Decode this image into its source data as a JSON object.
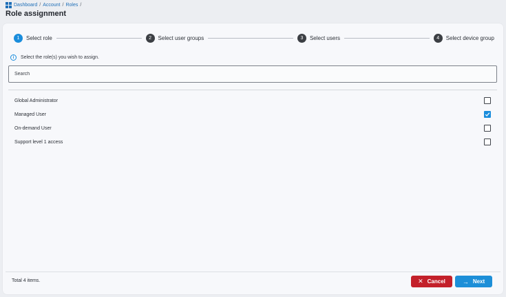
{
  "breadcrumb": {
    "items": [
      "Dashboard",
      "Account",
      "Roles"
    ],
    "separator": "/"
  },
  "page": {
    "title": "Role assignment"
  },
  "stepper": {
    "steps": [
      {
        "number": "1",
        "label": "Select role",
        "active": true
      },
      {
        "number": "2",
        "label": "Select user groups",
        "active": false
      },
      {
        "number": "3",
        "label": "Select users",
        "active": false
      },
      {
        "number": "4",
        "label": "Select device group",
        "active": false
      }
    ]
  },
  "info": {
    "icon": "info-icon",
    "text": "Select the role(s) you wish to assign."
  },
  "search": {
    "placeholder": "Search",
    "value": ""
  },
  "roles": [
    {
      "label": "Global Administrator",
      "checked": false
    },
    {
      "label": "Managed User",
      "checked": true
    },
    {
      "label": "On-demand User",
      "checked": false
    },
    {
      "label": "Support level 1 access",
      "checked": false
    }
  ],
  "footer": {
    "total_text": "Total 4 items.",
    "cancel_label": "Cancel",
    "next_label": "Next"
  },
  "colors": {
    "accent": "#1a8ddc",
    "cancel": "#c3202a",
    "next": "#1d8fd8",
    "link": "#1f6fb8"
  }
}
